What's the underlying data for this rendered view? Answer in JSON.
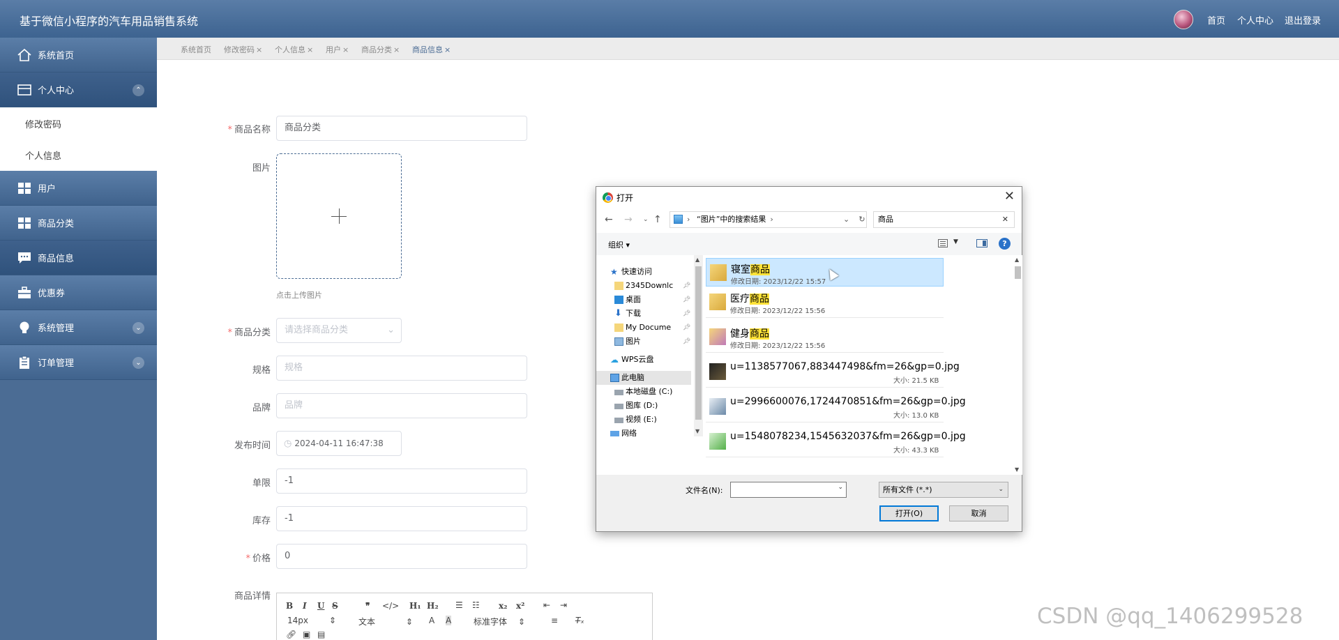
{
  "header": {
    "title": "基于微信小程序的汽车用品销售系统",
    "links": [
      "首页",
      "个人中心",
      "退出登录"
    ]
  },
  "sidebar": {
    "items": [
      {
        "label": "系统首页",
        "icon": "home-icon"
      },
      {
        "label": "个人中心",
        "icon": "card-icon"
      },
      {
        "label": "用户",
        "icon": "grid-icon"
      },
      {
        "label": "商品分类",
        "icon": "grid-icon"
      },
      {
        "label": "商品信息",
        "icon": "chat-icon"
      },
      {
        "label": "优惠券",
        "icon": "briefcase-icon"
      },
      {
        "label": "系统管理",
        "icon": "bulb-icon"
      },
      {
        "label": "订单管理",
        "icon": "clipboard-icon"
      }
    ],
    "submenu": [
      "修改密码",
      "个人信息"
    ]
  },
  "tabs": [
    "系统首页",
    "修改密码",
    "个人信息",
    "用户",
    "商品分类",
    "商品信息"
  ],
  "form": {
    "name_label": "商品名称",
    "name_value": "商品分类",
    "image_label": "图片",
    "upload_tip": "点击上传图片",
    "category_label": "商品分类",
    "category_placeholder": "请选择商品分类",
    "spec_label": "规格",
    "spec_placeholder": "规格",
    "brand_label": "品牌",
    "brand_placeholder": "品牌",
    "publish_label": "发布时间",
    "publish_value": "2024-04-11 16:47:38",
    "limit_label": "单限",
    "limit_value": "-1",
    "stock_label": "库存",
    "stock_value": "-1",
    "price_label": "价格",
    "price_value": "0",
    "detail_label": "商品详情"
  },
  "editor": {
    "size": "14px",
    "paragraph": "文本",
    "font": "标准字体"
  },
  "watermark": "CSDN @qq_1406299528",
  "dialog": {
    "title": "打开",
    "address": "“图片”中的搜索结果",
    "search": "商品",
    "organize": "组织 ▾",
    "nav": [
      {
        "label": "快速访问",
        "pin": false
      },
      {
        "label": "2345Downlc",
        "pin": true
      },
      {
        "label": "桌面",
        "pin": true
      },
      {
        "label": "下载",
        "pin": true
      },
      {
        "label": "My Docume",
        "pin": true
      },
      {
        "label": "图片",
        "pin": true
      },
      {
        "label": "WPS云盘",
        "pin": false
      },
      {
        "label": "此电脑",
        "pin": false
      },
      {
        "label": "本地磁盘 (C:)",
        "pin": false
      },
      {
        "label": "图库 (D:)",
        "pin": false
      },
      {
        "label": "视频 (E:)",
        "pin": false
      },
      {
        "label": "网络",
        "pin": false
      }
    ],
    "files": [
      {
        "prefix": "寝室",
        "highlight": "商品",
        "meta": "修改日期: 2023/12/22 15:57",
        "selected": true
      },
      {
        "prefix": "医疗",
        "highlight": "商品",
        "meta": "修改日期: 2023/12/22 15:56",
        "selected": false
      },
      {
        "prefix": "健身",
        "highlight": "商品",
        "meta": "修改日期: 2023/12/22 15:56",
        "selected": false
      },
      {
        "prefix": "u=1138577067,883447498&fm=26&gp=0.jpg",
        "highlight": "",
        "meta": "大小: 21.5 KB",
        "selected": false
      },
      {
        "prefix": "u=2996600076,1724470851&fm=26&gp=0.jpg",
        "highlight": "",
        "meta": "大小: 13.0 KB",
        "selected": false
      },
      {
        "prefix": "u=1548078234,1545632037&fm=26&gp=0.jpg",
        "highlight": "",
        "meta": "大小: 43.3 KB",
        "selected": false
      }
    ],
    "filename_label": "文件名(N):",
    "filetype": "所有文件 (*.*)",
    "open_label": "打开(O)",
    "cancel_label": "取消"
  }
}
